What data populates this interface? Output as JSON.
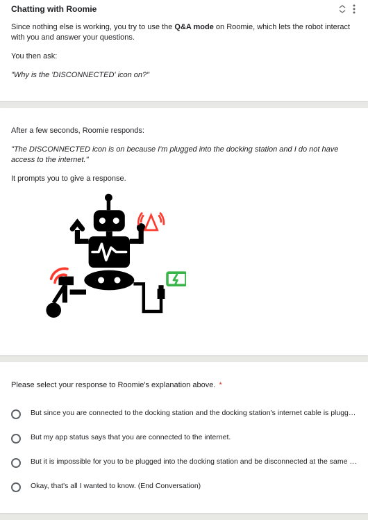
{
  "card1": {
    "title": "Chatting with Roomie",
    "intro_pre": "Since nothing else is working, you try to use the ",
    "intro_bold": "Q&A mode",
    "intro_post": " on Roomie, which lets the robot interact with you and answer your questions.",
    "then_ask": "You then ask:",
    "question": "\"Why is the 'DISCONNECTED' icon on?\""
  },
  "card2": {
    "lead": "After a few seconds, Roomie responds:",
    "quote": "\"The DISCONNECTED icon is on because I'm plugged into the docking station and I do not have access to the internet.\"",
    "prompt": "It prompts you to give a response."
  },
  "card3": {
    "question": "Please select your response to Roomie's explanation above.",
    "options": {
      "o0": "But since you are connected to the docking station and the docking station's internet cable is plugged in, ...",
      "o1": "But my app status says that you are connected to the internet.",
      "o2": "But it is impossible for you to be plugged into the docking station and be disconnected at the same time....",
      "o3": "Okay, that's all I wanted to know. (End Conversation)"
    }
  },
  "colors": {
    "accent": "#d93025",
    "green": "#39b54a",
    "red": "#ff3b2f"
  }
}
